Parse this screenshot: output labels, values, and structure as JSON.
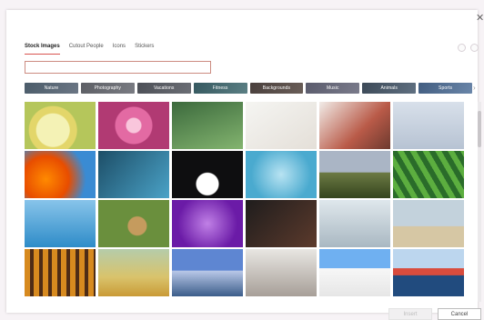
{
  "tabs": [
    "Stock Images",
    "Cutout People",
    "Icons",
    "Stickers"
  ],
  "active_tab": "Stock Images",
  "search": {
    "value": "",
    "placeholder": ""
  },
  "categories": [
    "Nature",
    "Photography",
    "Vacations",
    "Fitness",
    "Backgrounds",
    "Music",
    "Animals",
    "Sports"
  ],
  "buttons": {
    "insert": "Insert",
    "cancel": "Cancel"
  },
  "icons": {
    "close": "close-icon",
    "help": "help-icon",
    "settings": "settings-icon",
    "chevron": "chevron-right-icon"
  },
  "grid": {
    "rows": [
      [
        "lemon-slice",
        "pink-flower",
        "gloved-hand-plant",
        "hands-on-desk",
        "red-food-table",
        "dove-in-flight"
      ],
      [
        "orange-spiral",
        "blue-machine",
        "white-figure-dark",
        "blue-molecules",
        "valley-landscape",
        "green-peas"
      ],
      [
        "ocean-horizon",
        "cat-in-grass",
        "purple-bokeh",
        "hands-holding",
        "people-meeting",
        "beach-walk"
      ],
      [
        "building-grid",
        "woman-field",
        "sailboat",
        "laptop-workspace",
        "clouds-sky",
        "golden-gate"
      ]
    ]
  }
}
